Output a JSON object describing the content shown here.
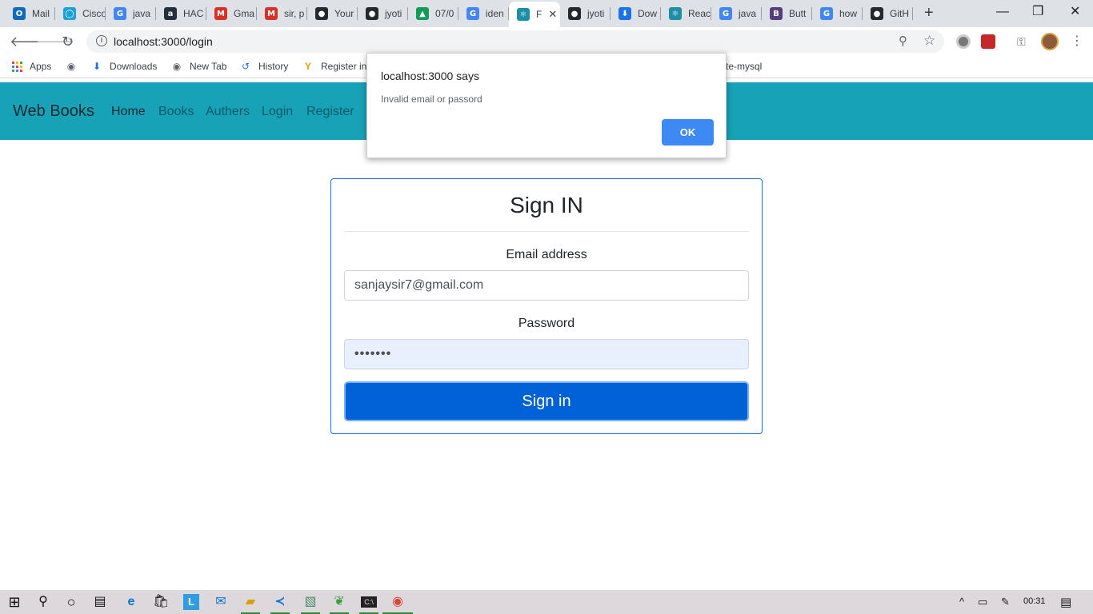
{
  "browser": {
    "tabs": [
      {
        "label": "Mail",
        "icon": "outlook-icon",
        "color": "#0f6cbd",
        "glyph": "O"
      },
      {
        "label": "Cisco",
        "icon": "cisco-icon",
        "color": "#1ba0d7",
        "glyph": "◯"
      },
      {
        "label": "java",
        "icon": "google-icon",
        "color": "#4285f4",
        "glyph": "G"
      },
      {
        "label": "HAC",
        "icon": "amazon-icon",
        "color": "#232f3e",
        "glyph": "a"
      },
      {
        "label": "Gma",
        "icon": "gmail-icon",
        "color": "#d93025",
        "glyph": "M"
      },
      {
        "label": "sir, p",
        "icon": "gmail-icon",
        "color": "#d93025",
        "glyph": "M"
      },
      {
        "label": "Your",
        "icon": "github-icon",
        "color": "#24292e",
        "glyph": "●"
      },
      {
        "label": "jyoti",
        "icon": "github-icon",
        "color": "#24292e",
        "glyph": "●"
      },
      {
        "label": "07/0",
        "icon": "drive-icon",
        "color": "#0f9d58",
        "glyph": "▲"
      },
      {
        "label": "iden",
        "icon": "google-icon",
        "color": "#4285f4",
        "glyph": "G"
      },
      {
        "label": "F",
        "icon": "react-icon",
        "color": "#1b8fa6",
        "glyph": "⚛",
        "active": true
      },
      {
        "label": "jyoti",
        "icon": "github-icon",
        "color": "#24292e",
        "glyph": "●"
      },
      {
        "label": "Dow",
        "icon": "download-icon",
        "color": "#1a73e8",
        "glyph": "⬇"
      },
      {
        "label": "Reac",
        "icon": "react-icon",
        "color": "#1b8fa6",
        "glyph": "⚛"
      },
      {
        "label": "java",
        "icon": "google-icon",
        "color": "#4285f4",
        "glyph": "G"
      },
      {
        "label": "Butt",
        "icon": "bootstrap-icon",
        "color": "#563d7c",
        "glyph": "B"
      },
      {
        "label": "how",
        "icon": "google-icon",
        "color": "#4285f4",
        "glyph": "G"
      },
      {
        "label": "GitH",
        "icon": "github-icon",
        "color": "#24292e",
        "glyph": "●"
      }
    ],
    "tab_close": "✕",
    "new_tab": "+",
    "minimize": "—",
    "restore": "❐",
    "close": "✕",
    "url": "localhost:3000/login",
    "info_glyph": "i",
    "bookmarks": [
      {
        "label": "Apps",
        "icon": "apps-grid-icon"
      },
      {
        "label": "",
        "icon": "globe-icon",
        "glyph": "🌐"
      },
      {
        "label": "Downloads",
        "icon": "download-icon",
        "glyph": "⬇"
      },
      {
        "label": "New Tab",
        "icon": "globe-icon",
        "glyph": "🌐"
      },
      {
        "label": "History",
        "icon": "history-icon",
        "glyph": "↺"
      },
      {
        "label": "Register in",
        "icon": "hackerearth-icon",
        "glyph": "Y"
      },
      {
        "label": "te-mysql",
        "icon": "",
        "glyph": ""
      }
    ],
    "apps_grid_colors": [
      "#ea4335",
      "#fbbc05",
      "#34a853",
      "#4285f4",
      "#ea4335",
      "#fbbc05",
      "#34a853",
      "#4285f4",
      "#ea4335"
    ]
  },
  "app": {
    "brand": "Web Books",
    "nav": [
      "Home",
      "Books",
      "Authers",
      "Login",
      "Register"
    ]
  },
  "signin": {
    "title": "Sign IN",
    "email_label": "Email address",
    "email_value": "sanjaysir7@gmail.com",
    "password_label": "Password",
    "password_value": "•••••••",
    "submit_label": "Sign in"
  },
  "alert": {
    "title": "localhost:3000 says",
    "message": "Invalid email or passord",
    "ok_label": "OK"
  },
  "taskbar": {
    "clock": "00:31",
    "start_glyph": "⊞",
    "search_glyph": "⚲",
    "cortana_glyph": "○"
  },
  "colors": {
    "navbar": "#17a2b8",
    "primary_button": "#0062d6",
    "dialog_ok": "#3d8af5"
  }
}
